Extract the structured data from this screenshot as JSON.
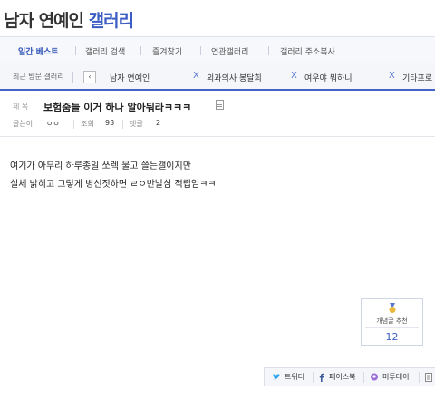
{
  "gallery": {
    "title_prefix": "남자 연예인",
    "title_suffix": "갤러리"
  },
  "nav": {
    "items": [
      "일간 베스트",
      "갤러리 검색",
      "즐겨찾기",
      "연관갤러리",
      "갤러리 주소복사"
    ]
  },
  "recent": {
    "label": "최근 방문 갤러리",
    "prev_glyph": "‹",
    "remove_glyph": "X",
    "galleries": [
      "남자 연예인",
      "외과의사 봉달희",
      "여우야 뭐하니",
      "기타프로"
    ]
  },
  "post": {
    "subject_label": "제 목",
    "title": "보험줌들 이거 하나 알아둬라ㅋㅋㅋ",
    "writer_label": "글쓴이",
    "writer": "ㅇㅇ",
    "views_label": "조회",
    "views": "93",
    "comments_label": "댓글",
    "comments": "2",
    "body": [
      "여기가 아무리 하루종일 쏘렉 물고 쓸는갤이지만",
      "실체 밝히고 그렇게 병신짓하면 ㄹㅇ반발심 적립임ㅋㅋ"
    ]
  },
  "recommend": {
    "label": "개념글 추천",
    "count": "12"
  },
  "share": {
    "twitter": "트위터",
    "facebook": "페이스북",
    "me2day": "미투데이"
  },
  "colors": {
    "accent": "#3b5cc5",
    "twitter": "#2aa3ef",
    "facebook": "#3b5998",
    "me2day": "#9b6fd6",
    "medal": "#e8b93c"
  },
  "icons": [
    "chevron-left-icon",
    "remove-x-icon",
    "document-icon",
    "medal-icon",
    "twitter-icon",
    "facebook-icon",
    "me2day-icon",
    "more-icon"
  ]
}
